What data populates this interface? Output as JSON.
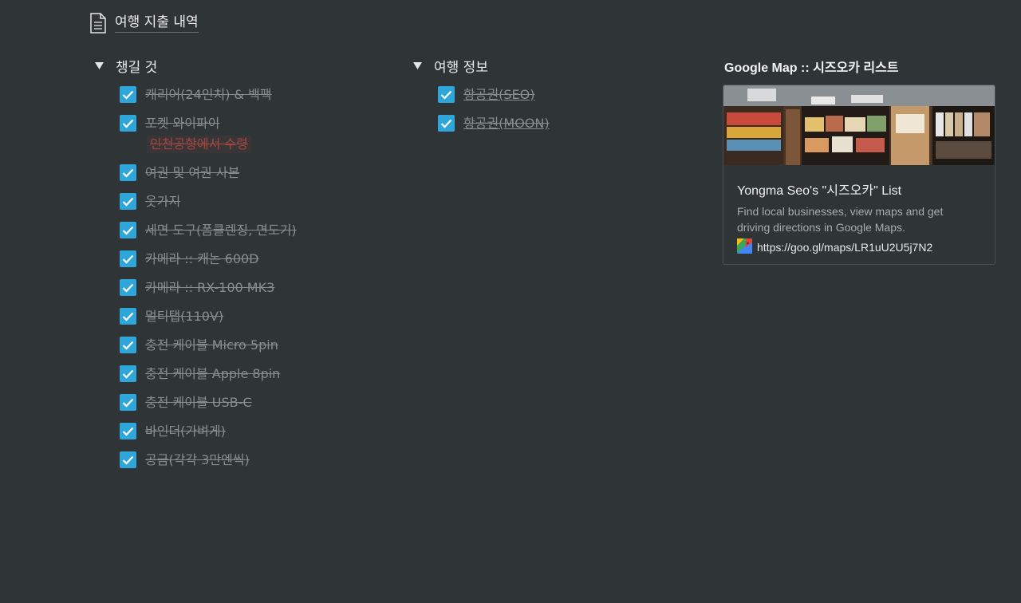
{
  "page_link": {
    "label": "여행 지출 내역",
    "icon": "document-icon"
  },
  "packing": {
    "title": "챙길 것",
    "items": [
      {
        "text": "캐리어(24인치) & 백팩",
        "checked": true
      },
      {
        "text": "포켓 와이파이",
        "checked": true,
        "note": "인천공항에서  수령"
      },
      {
        "text": "여권 및 여권 사본",
        "checked": true
      },
      {
        "text": "옷가지",
        "checked": true
      },
      {
        "text": "세면 도구(폼클렌징, 면도기)",
        "checked": true
      },
      {
        "text": "카메라 :: 캐논 600D",
        "checked": true
      },
      {
        "text": "카메라 :: RX-100 MK3",
        "checked": true
      },
      {
        "text": "멀티탭(110V)",
        "checked": true
      },
      {
        "text": "충전 케이블 Micro 5pin",
        "checked": true
      },
      {
        "text": "충전 케이블 Apple 8pin",
        "checked": true
      },
      {
        "text": "충전 케이블 USB-C",
        "checked": true
      },
      {
        "text": "바인더(가벼게)",
        "checked": true
      },
      {
        "text": "공금(각각 3만엔씩)",
        "checked": true
      }
    ]
  },
  "travel_info": {
    "title": "여행 정보",
    "items": [
      {
        "text": "항공권(SEO)",
        "checked": true
      },
      {
        "text": "항공권(MOON)",
        "checked": true
      }
    ]
  },
  "bookmark": {
    "section_title": "Google Map :: 시즈오카 리스트",
    "heading": "Yongma Seo's \"시즈오카\" List",
    "description": "Find local businesses, view maps and get driving directions in Google Maps.",
    "url": "https://goo.gl/maps/LR1uU2U5j7N2"
  },
  "colors": {
    "background": "#2f3437",
    "checkbox": "#2ea6d9",
    "note": "#a14743"
  }
}
